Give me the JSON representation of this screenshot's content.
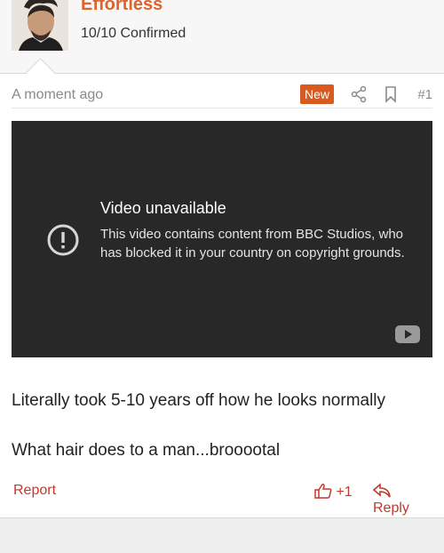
{
  "user": {
    "name": "Effortless",
    "title": "10/10 Confirmed"
  },
  "post": {
    "timestamp": "A moment ago",
    "badge": "New",
    "number": "#1",
    "body_lines": [
      "Literally took 5-10 years off how he looks normally",
      "What hair does to a man...brooootal"
    ]
  },
  "video": {
    "title": "Video unavailable",
    "message": "This video contains content from BBC Studios, who has blocked it in your country on copyright grounds."
  },
  "actions": {
    "report": "Report",
    "like_count": "+1",
    "reply": "Reply"
  },
  "colors": {
    "accent": "#e0632b",
    "badge": "#d95a1e",
    "action": "#c0392b",
    "video_bg": "#282828"
  }
}
